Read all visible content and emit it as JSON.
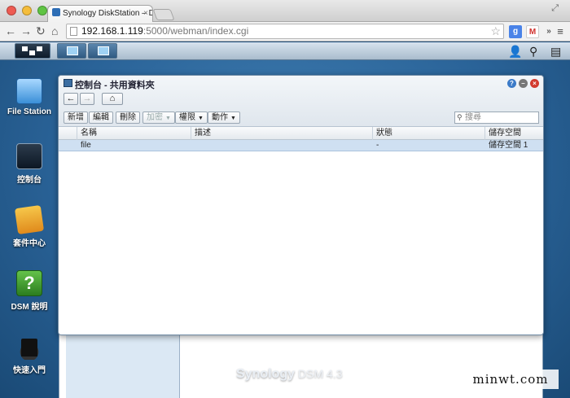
{
  "browser": {
    "tab_title": "Synology DiskStation – DS",
    "tab_close": "×",
    "url_host": "192.168.1.119",
    "url_rest": ":5000/webman/index.cgi",
    "nav": {
      "back": "←",
      "forward": "→",
      "reload": "↻",
      "home": "⌂"
    },
    "ext_more": "»",
    "ext_menu": "≡",
    "star": "☆"
  },
  "taskbar": {
    "right": {
      "user": "👤",
      "search": "⚲",
      "widgets": "▤"
    }
  },
  "desktop": {
    "icons": [
      {
        "label": "File Station"
      },
      {
        "label": "控制台"
      },
      {
        "label": "套件中心"
      },
      {
        "label": "DSM 說明",
        "glyph": "?"
      },
      {
        "label": "快速入門"
      }
    ],
    "brand": "Synology",
    "brand_version": "DSM 4.3",
    "watermark": "minwt.com"
  },
  "window": {
    "title": "控制台 - 共用資料夾",
    "controls": {
      "help": "?",
      "minimize": "–",
      "close": "×"
    },
    "toolbar": {
      "new": "新增",
      "edit": "編輯",
      "delete": "刪除",
      "encrypt": "加密",
      "permission": "權限",
      "action": "動作",
      "search_placeholder": "搜尋"
    },
    "columns": {
      "name": "名稱",
      "description": "描述",
      "status": "狀態",
      "volume": "儲存空間"
    },
    "rows": [
      {
        "name": "file",
        "description": "",
        "status": "-",
        "volume": "儲存空間 1"
      }
    ]
  }
}
